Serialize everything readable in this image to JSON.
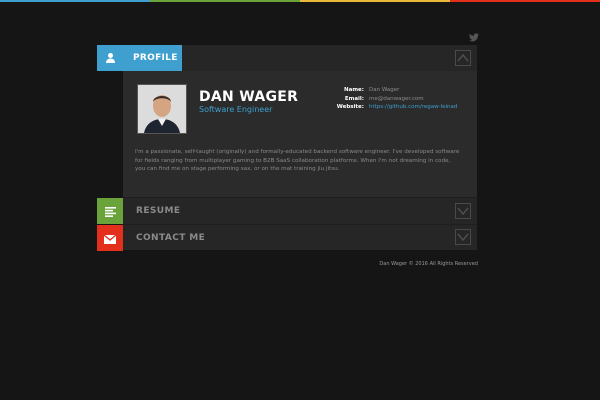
{
  "colors": {
    "background": "#151515",
    "panel": "#262626",
    "accent_blue": "#3f9fcf",
    "accent_green": "#6aa33a",
    "accent_red": "#e2301c",
    "top_bar": [
      "#3f9fcf",
      "#6aa33a",
      "#e8b83a",
      "#e2301c"
    ]
  },
  "header": {
    "twitter_icon": "twitter-icon"
  },
  "sections": {
    "profile": {
      "label": "PROFILE",
      "icon": "user-icon",
      "toggle_icon": "chevron-up-icon"
    },
    "resume": {
      "label": "RESUME",
      "icon": "list-icon",
      "toggle_icon": "chevron-down-icon"
    },
    "contact": {
      "label": "CONTACT ME",
      "icon": "envelope-icon",
      "toggle_icon": "chevron-down-icon"
    }
  },
  "profile": {
    "name": "DAN WAGER",
    "title": "Software Engineer",
    "info": {
      "name_key": "Name:",
      "name_value": "Dan Wager",
      "email_key": "Email:",
      "email_value": "me@danwager.com",
      "website_key": "Website:",
      "website_value": "https://github.com/regaw-leinad"
    },
    "bio": "I'm a passionate, self-taught (originally) and formally-educated backend software engineer. I've developed software for fields ranging from multiplayer gaming to B2B SaaS collaboration platforms. When I'm not dreaming in code, you can find me on stage performing sax, or on the mat training jiu jitsu."
  },
  "footer": {
    "text": "Dan Wager © 2016 All Rights Reserved"
  }
}
